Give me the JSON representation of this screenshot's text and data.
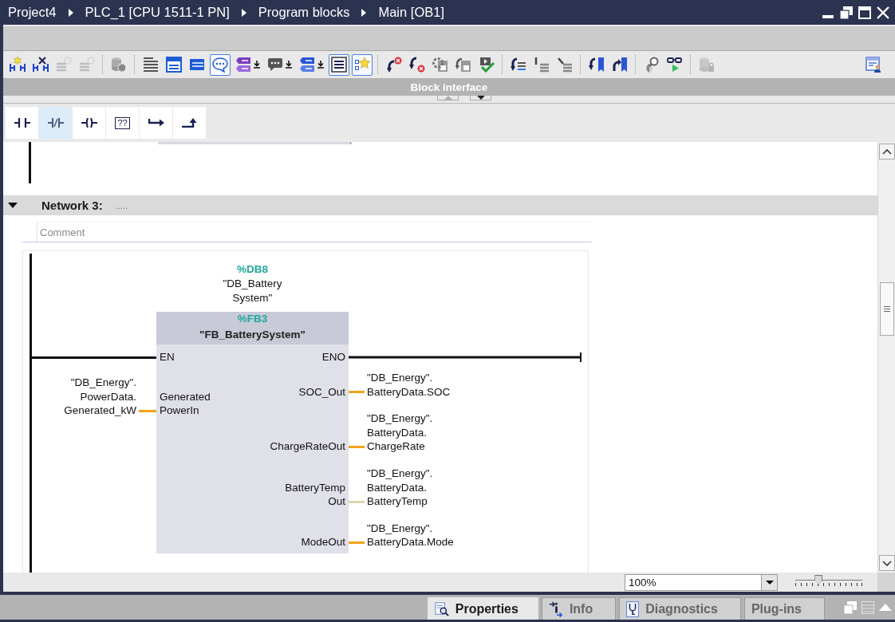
{
  "title_bar": {
    "breadcrumbs": [
      "Project4",
      "PLC_1 [CPU 1511-1 PN]",
      "Program blocks",
      "Main [OB1]"
    ]
  },
  "toolbar": {
    "groups": [
      {
        "buttons": [
          {
            "kind": "plain",
            "on": false,
            "disabled": false
          },
          {
            "kind": "plain",
            "on": false,
            "disabled": false
          },
          {
            "kind": "plain",
            "on": false,
            "disabled": true
          },
          {
            "kind": "plain",
            "on": false,
            "disabled": true
          }
        ]
      },
      {
        "buttons": [
          {
            "kind": "plain",
            "on": false,
            "disabled": false
          }
        ]
      },
      {
        "buttons": [
          {
            "kind": "plain",
            "on": false,
            "disabled": false
          },
          {
            "kind": "plain",
            "on": false,
            "disabled": false
          },
          {
            "kind": "plain",
            "on": false,
            "disabled": false
          },
          {
            "kind": "plain",
            "on": true,
            "disabled": false
          },
          {
            "kind": "split",
            "on": false,
            "disabled": false
          },
          {
            "kind": "split",
            "on": false,
            "disabled": false
          },
          {
            "kind": "split",
            "on": false,
            "disabled": false
          },
          {
            "kind": "plain",
            "on": true,
            "disabled": false
          },
          {
            "kind": "plain",
            "on": true,
            "disabled": false
          }
        ]
      },
      {
        "buttons": [
          {
            "kind": "plain",
            "on": false,
            "disabled": false
          },
          {
            "kind": "plain",
            "on": false,
            "disabled": false
          },
          {
            "kind": "plain",
            "on": false,
            "disabled": false
          },
          {
            "kind": "plain",
            "on": false,
            "disabled": false
          },
          {
            "kind": "plain",
            "on": false,
            "disabled": false
          }
        ]
      },
      {
        "buttons": [
          {
            "kind": "plain",
            "on": false,
            "disabled": false
          },
          {
            "kind": "plain",
            "on": false,
            "disabled": false
          },
          {
            "kind": "plain",
            "on": false,
            "disabled": false
          }
        ]
      },
      {
        "buttons": [
          {
            "kind": "plain",
            "on": false,
            "disabled": false
          },
          {
            "kind": "plain",
            "on": false,
            "disabled": false
          }
        ]
      },
      {
        "buttons": [
          {
            "kind": "plain",
            "on": false,
            "disabled": false
          },
          {
            "kind": "plain",
            "on": false,
            "disabled": false
          }
        ]
      },
      {
        "buttons": [
          {
            "kind": "plain",
            "on": false,
            "disabled": true
          }
        ]
      }
    ],
    "end_buttons": [
      {
        "on": false,
        "disabled": false
      }
    ]
  },
  "block_interface": {
    "label": "Block interface"
  },
  "lad_elements": [
    {
      "highlighted": false
    },
    {
      "highlighted": true
    },
    {
      "highlighted": false
    },
    {
      "highlighted": false,
      "label": "??"
    },
    {
      "highlighted": false
    },
    {
      "highlighted": false
    }
  ],
  "editor": {
    "network": {
      "expanded": true,
      "title": "Network 3:",
      "title_comment": ".....",
      "comment_placeholder": "Comment",
      "instance": {
        "address": "%DB8",
        "name": "\"DB_Battery\nSystem\""
      },
      "block": {
        "address": "%FB3",
        "name": "\"FB_BatterySystem\"",
        "en": "EN",
        "eno": "ENO",
        "inputs": [
          {
            "pin": "Generated\nPowerIn",
            "operand": "\"DB_Energy\".\nPowerData.\nGenerated_kW",
            "color": "#f5a11c"
          }
        ],
        "outputs": [
          {
            "pin": "SOC_Out",
            "operand": "\"DB_Energy\".\nBatteryData.SOC",
            "color": "#f5a11c"
          },
          {
            "pin": "ChargeRateOut",
            "operand": "\"DB_Energy\".\nBatteryData.\nChargeRate",
            "color": "#f5a11c"
          },
          {
            "pin": "BatteryTemp\nOut",
            "operand": "\"DB_Energy\".\nBatteryData.\nBatteryTemp",
            "color": "#ddd5b0"
          },
          {
            "pin": "ModeOut",
            "operand": "\"DB_Energy\".\nBatteryData.Mode",
            "color": "#f5a11c"
          }
        ]
      }
    }
  },
  "zoom": {
    "value": "100%",
    "level": 0.35
  },
  "bottom_tabs": [
    {
      "label": "Properties",
      "selected": true
    },
    {
      "label": "Info",
      "selected": false
    },
    {
      "label": "Diagnostics",
      "selected": false
    },
    {
      "label": "Plug-ins",
      "selected": false
    }
  ]
}
